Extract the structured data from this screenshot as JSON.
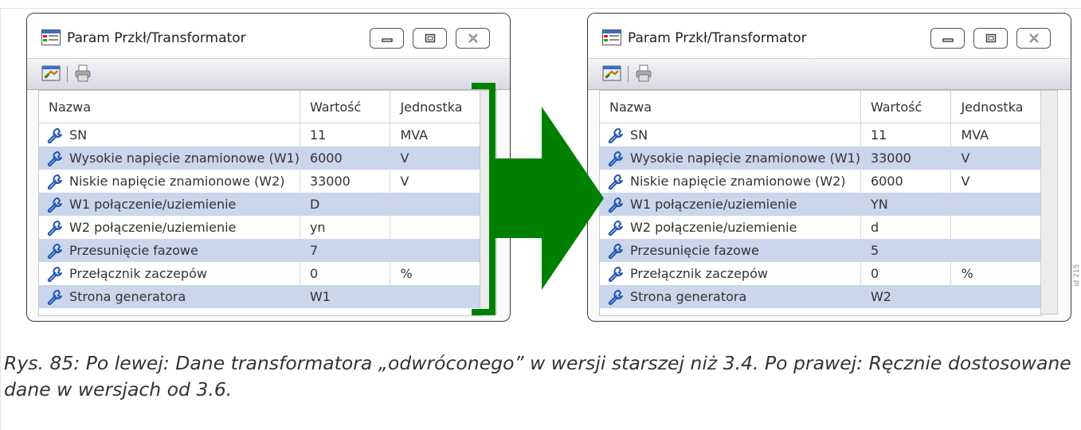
{
  "windows": [
    {
      "title": "Param Przkł/Transformator",
      "columns": [
        "Nazwa",
        "Wartość",
        "Jednostka"
      ],
      "rows": [
        {
          "name": "SN",
          "value": "11",
          "unit": "MVA"
        },
        {
          "name": "Wysokie napięcie znamionowe (W1)",
          "value": "6000",
          "unit": "V"
        },
        {
          "name": "Niskie napięcie znamionowe (W2)",
          "value": "33000",
          "unit": "V"
        },
        {
          "name": "W1 połączenie/uziemienie",
          "value": "D",
          "unit": ""
        },
        {
          "name": "W2 połączenie/uziemienie",
          "value": "yn",
          "unit": ""
        },
        {
          "name": "Przesunięcie fazowe",
          "value": "7",
          "unit": ""
        },
        {
          "name": "Przełącznik zaczepów",
          "value": "0",
          "unit": "%"
        },
        {
          "name": "Strona generatora",
          "value": "W1",
          "unit": ""
        }
      ]
    },
    {
      "title": "Param Przkł/Transformator",
      "columns": [
        "Nazwa",
        "Wartość",
        "Jednostka"
      ],
      "rows": [
        {
          "name": "SN",
          "value": "11",
          "unit": "MVA"
        },
        {
          "name": "Wysokie napięcie znamionowe (W1)",
          "value": "33000",
          "unit": "V"
        },
        {
          "name": "Niskie napięcie znamionowe (W2)",
          "value": "6000",
          "unit": "V"
        },
        {
          "name": "W1 połączenie/uziemienie",
          "value": "YN",
          "unit": ""
        },
        {
          "name": "W2 połączenie/uziemienie",
          "value": "d",
          "unit": ""
        },
        {
          "name": "Przesunięcie fazowe",
          "value": "5",
          "unit": ""
        },
        {
          "name": "Przełącznik zaczepów",
          "value": "0",
          "unit": "%"
        },
        {
          "name": "Strona generatora",
          "value": "W2",
          "unit": ""
        }
      ]
    }
  ],
  "id_tag": "id 215",
  "caption": "Rys. 85: Po lewej: Dane transformatora „odwróconego” w wersji starszej niż 3.4. Po prawej: Ręcznie dostosowane dane w wersjach od 3.6.",
  "colors": {
    "arrow": "#008000",
    "row_alt": "#c9d6ec"
  },
  "icons": [
    "app-window-icon",
    "minimize-icon",
    "maximize-icon",
    "close-icon",
    "edit-settings-icon",
    "print-icon",
    "wrench-icon"
  ]
}
